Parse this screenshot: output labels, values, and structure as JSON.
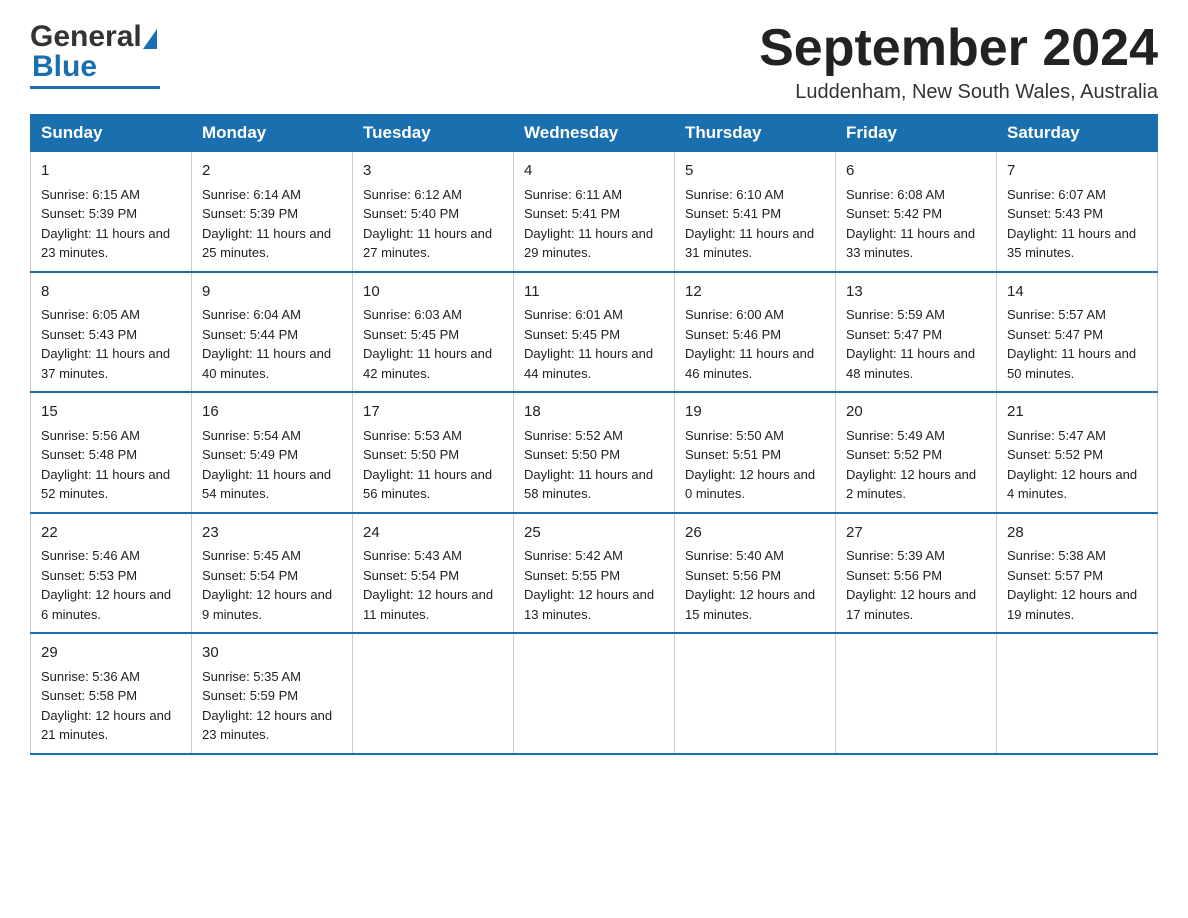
{
  "header": {
    "logo_general": "General",
    "logo_blue": "Blue",
    "month_title": "September 2024",
    "location": "Luddenham, New South Wales, Australia"
  },
  "days_of_week": [
    "Sunday",
    "Monday",
    "Tuesday",
    "Wednesday",
    "Thursday",
    "Friday",
    "Saturday"
  ],
  "weeks": [
    [
      {
        "day": "1",
        "sunrise": "6:15 AM",
        "sunset": "5:39 PM",
        "daylight": "11 hours and 23 minutes."
      },
      {
        "day": "2",
        "sunrise": "6:14 AM",
        "sunset": "5:39 PM",
        "daylight": "11 hours and 25 minutes."
      },
      {
        "day": "3",
        "sunrise": "6:12 AM",
        "sunset": "5:40 PM",
        "daylight": "11 hours and 27 minutes."
      },
      {
        "day": "4",
        "sunrise": "6:11 AM",
        "sunset": "5:41 PM",
        "daylight": "11 hours and 29 minutes."
      },
      {
        "day": "5",
        "sunrise": "6:10 AM",
        "sunset": "5:41 PM",
        "daylight": "11 hours and 31 minutes."
      },
      {
        "day": "6",
        "sunrise": "6:08 AM",
        "sunset": "5:42 PM",
        "daylight": "11 hours and 33 minutes."
      },
      {
        "day": "7",
        "sunrise": "6:07 AM",
        "sunset": "5:43 PM",
        "daylight": "11 hours and 35 minutes."
      }
    ],
    [
      {
        "day": "8",
        "sunrise": "6:05 AM",
        "sunset": "5:43 PM",
        "daylight": "11 hours and 37 minutes."
      },
      {
        "day": "9",
        "sunrise": "6:04 AM",
        "sunset": "5:44 PM",
        "daylight": "11 hours and 40 minutes."
      },
      {
        "day": "10",
        "sunrise": "6:03 AM",
        "sunset": "5:45 PM",
        "daylight": "11 hours and 42 minutes."
      },
      {
        "day": "11",
        "sunrise": "6:01 AM",
        "sunset": "5:45 PM",
        "daylight": "11 hours and 44 minutes."
      },
      {
        "day": "12",
        "sunrise": "6:00 AM",
        "sunset": "5:46 PM",
        "daylight": "11 hours and 46 minutes."
      },
      {
        "day": "13",
        "sunrise": "5:59 AM",
        "sunset": "5:47 PM",
        "daylight": "11 hours and 48 minutes."
      },
      {
        "day": "14",
        "sunrise": "5:57 AM",
        "sunset": "5:47 PM",
        "daylight": "11 hours and 50 minutes."
      }
    ],
    [
      {
        "day": "15",
        "sunrise": "5:56 AM",
        "sunset": "5:48 PM",
        "daylight": "11 hours and 52 minutes."
      },
      {
        "day": "16",
        "sunrise": "5:54 AM",
        "sunset": "5:49 PM",
        "daylight": "11 hours and 54 minutes."
      },
      {
        "day": "17",
        "sunrise": "5:53 AM",
        "sunset": "5:50 PM",
        "daylight": "11 hours and 56 minutes."
      },
      {
        "day": "18",
        "sunrise": "5:52 AM",
        "sunset": "5:50 PM",
        "daylight": "11 hours and 58 minutes."
      },
      {
        "day": "19",
        "sunrise": "5:50 AM",
        "sunset": "5:51 PM",
        "daylight": "12 hours and 0 minutes."
      },
      {
        "day": "20",
        "sunrise": "5:49 AM",
        "sunset": "5:52 PM",
        "daylight": "12 hours and 2 minutes."
      },
      {
        "day": "21",
        "sunrise": "5:47 AM",
        "sunset": "5:52 PM",
        "daylight": "12 hours and 4 minutes."
      }
    ],
    [
      {
        "day": "22",
        "sunrise": "5:46 AM",
        "sunset": "5:53 PM",
        "daylight": "12 hours and 6 minutes."
      },
      {
        "day": "23",
        "sunrise": "5:45 AM",
        "sunset": "5:54 PM",
        "daylight": "12 hours and 9 minutes."
      },
      {
        "day": "24",
        "sunrise": "5:43 AM",
        "sunset": "5:54 PM",
        "daylight": "12 hours and 11 minutes."
      },
      {
        "day": "25",
        "sunrise": "5:42 AM",
        "sunset": "5:55 PM",
        "daylight": "12 hours and 13 minutes."
      },
      {
        "day": "26",
        "sunrise": "5:40 AM",
        "sunset": "5:56 PM",
        "daylight": "12 hours and 15 minutes."
      },
      {
        "day": "27",
        "sunrise": "5:39 AM",
        "sunset": "5:56 PM",
        "daylight": "12 hours and 17 minutes."
      },
      {
        "day": "28",
        "sunrise": "5:38 AM",
        "sunset": "5:57 PM",
        "daylight": "12 hours and 19 minutes."
      }
    ],
    [
      {
        "day": "29",
        "sunrise": "5:36 AM",
        "sunset": "5:58 PM",
        "daylight": "12 hours and 21 minutes."
      },
      {
        "day": "30",
        "sunrise": "5:35 AM",
        "sunset": "5:59 PM",
        "daylight": "12 hours and 23 minutes."
      },
      null,
      null,
      null,
      null,
      null
    ]
  ]
}
